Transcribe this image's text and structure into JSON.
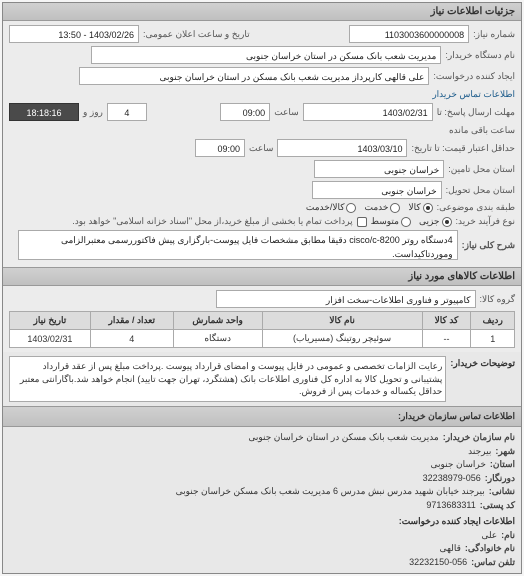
{
  "panel_title": "جزئیات اطلاعات نیاز",
  "labels": {
    "number": "شماره نیاز:",
    "public_date": "تاریخ و ساعت اعلان عمومی:",
    "buyer_org": "نام دستگاه خریدار:",
    "requester": "ایجاد کننده درخواست:",
    "requester_contact": "اطلاعات تماس خریدار",
    "deadline": "مهلت ارسال پاسخ: تا",
    "at": "ساعت",
    "valid_until": "حداقل اعتبار قیمت: تا تاریخ:",
    "supply_province": "استان محل تامین:",
    "delivery_province": "استان محل تحویل:",
    "pack_type": "طبقه بندی موضوعی:",
    "pay_type": "نوع فرآیند خرید:",
    "pay_note": "پرداخت تمام یا بخشی از مبلغ خرید،از محل \"اسناد خزانه اسلامی\" خواهد بود.",
    "need_title": "شرح کلی نیاز:",
    "goods_title": "اطلاعات کالاهای مورد نیاز",
    "group": "گروه کالا:",
    "remaining_days": "روز و",
    "remaining_time": "ساعت باقی مانده",
    "desc": "توضیحات خریدار:"
  },
  "values": {
    "number": "1103003600000008",
    "public_date": "1403/02/26 - 13:50",
    "buyer_org": "مدیریت شعب بانک مسکن در استان خراسان جنوبی",
    "requester": "علی قالهی کارپرداز مدیریت شعب بانک مسکن در استان خراسان جنوبی",
    "deadline_date": "1403/02/31",
    "deadline_time": "09:00",
    "remaining_days": "4",
    "remaining_time": "18:18:16",
    "valid_until_date": "1403/03/10",
    "valid_until_time": "09:00",
    "province": "خراسان جنوبی",
    "need_title": "4دستگاه روتر cisco/c-8200 دقیقا مطابق مشخصات فایل پیوست-بارگزاری پیش فاکتوررسمی معتبرالزامی وموردتاکیداست.",
    "group": "کامپیوتر و فناوری اطلاعات-سخت افزار",
    "desc": "رعایت الزامات تخصصی و عمومی در فایل پیوست و امضای قرارداد پیوست .پرداخت مبلغ پس از عقد قرارداد پشتیبانی و تحویل کالا به اداره کل فناوری اطلاعات بانک (هشتگرد، تهران جهت تایید) انجام خواهد شد.باگارانتی معتبر حداقل یکساله و خدمات پس از فروش."
  },
  "radios": {
    "goods": "کالا",
    "service": "خدمت",
    "both": "کالا/خدمت",
    "low": "جزیی",
    "mid": "متوسط"
  },
  "table": {
    "headers": {
      "row": "ردیف",
      "code": "کد کالا",
      "name": "نام کالا",
      "unit": "واحد شمارش",
      "qty": "تعداد / مقدار",
      "date": "تاریخ نیاز"
    },
    "rows": [
      {
        "row": "1",
        "code": "--",
        "name": "سوئیچر روتینگ (مسیریاب)",
        "unit": "دستگاه",
        "qty": "4",
        "date": "1403/02/31"
      }
    ]
  },
  "contact": {
    "title": "اطلاعات تماس سازمان خریدار:",
    "org_k": "نام سازمان خریدار:",
    "org_v": "مدیریت شعب بانک مسکن در استان خراسان جنوبی",
    "city_k": "شهر:",
    "city_v": "بیرجند",
    "prov_k": "استان:",
    "prov_v": "خراسان جنوبی",
    "fax_k": "دورنگار:",
    "fax_v": "32238979-056",
    "addr_k": "نشانی:",
    "addr_v": "بیرجند خیابان شهید مدرس نبش مدرس 6 مدیریت شعب بانک مسکن خراسان جنوبی",
    "post_k": "کد پستی:",
    "post_v": "9713683311",
    "req_title": "اطلاعات ایجاد کننده درخواست:",
    "name_k": "نام:",
    "name_v": "علی",
    "lname_k": "نام خانوادگی:",
    "lname_v": "قالهی",
    "tel_k": "تلفن تماس:",
    "tel_v": "32232150-056"
  }
}
